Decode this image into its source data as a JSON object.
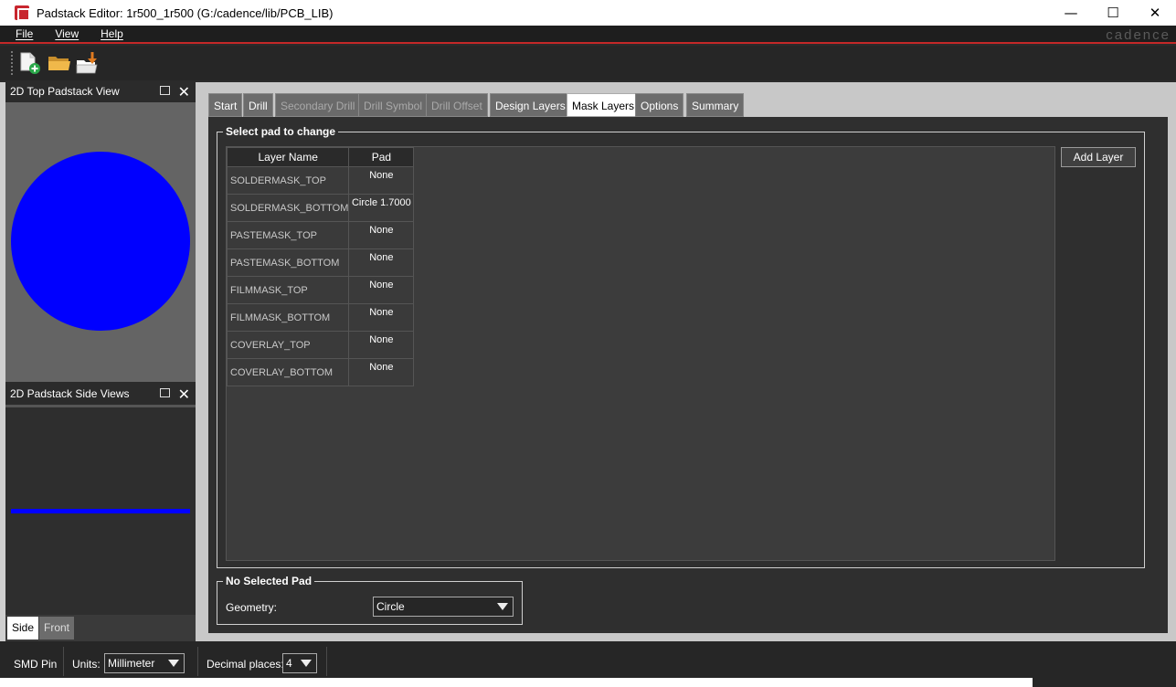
{
  "window": {
    "title": "Padstack Editor: 1r500_1r500  (G:/cadence/lib/PCB_LIB)",
    "minimize": "—",
    "maximize": "☐",
    "close": "✕"
  },
  "menubar": {
    "items": [
      "File",
      "View",
      "Help"
    ],
    "brand": "cadence"
  },
  "toolbar": {
    "icons": [
      "new-document-icon",
      "open-folder-icon",
      "import-folder-icon"
    ]
  },
  "left_panels": {
    "top_view": {
      "title": "2D Top Padstack View",
      "pad_color": "#0000ff"
    },
    "side_view": {
      "title": "2D Padstack Side Views",
      "pad_color": "#0000ff"
    },
    "side_tabs": [
      "Side",
      "Front"
    ]
  },
  "tabs": [
    {
      "label": "Start",
      "state": "normal"
    },
    {
      "label": "Drill",
      "state": "normal"
    },
    {
      "label": "Secondary Drill",
      "state": "disabled"
    },
    {
      "label": "Drill Symbol",
      "state": "disabled"
    },
    {
      "label": "Drill Offset",
      "state": "disabled"
    },
    {
      "label": "Design Layers",
      "state": "normal"
    },
    {
      "label": "Mask Layers",
      "state": "active"
    },
    {
      "label": "Options",
      "state": "normal"
    },
    {
      "label": "Summary",
      "state": "normal"
    }
  ],
  "select_pad": {
    "group_title": "Select pad to change",
    "columns": [
      "Layer Name",
      "Pad"
    ],
    "rows": [
      {
        "layer": "SOLDERMASK_TOP",
        "pad": "None"
      },
      {
        "layer": "SOLDERMASK_BOTTOM",
        "pad": "Circle 1.7000"
      },
      {
        "layer": "PASTEMASK_TOP",
        "pad": "None"
      },
      {
        "layer": "PASTEMASK_BOTTOM",
        "pad": "None"
      },
      {
        "layer": "FILMMASK_TOP",
        "pad": "None"
      },
      {
        "layer": "FILMMASK_BOTTOM",
        "pad": "None"
      },
      {
        "layer": "COVERLAY_TOP",
        "pad": "None"
      },
      {
        "layer": "COVERLAY_BOTTOM",
        "pad": "None"
      }
    ],
    "add_layer_button": "Add Layer"
  },
  "no_selected_pad": {
    "group_title": "No Selected Pad",
    "geometry_label": "Geometry:",
    "geometry_value": "Circle"
  },
  "statusbar": {
    "pin_type": "SMD Pin",
    "units_label": "Units:",
    "units_value": "Millimeter",
    "decimal_label": "Decimal places:",
    "decimal_value": "4"
  }
}
